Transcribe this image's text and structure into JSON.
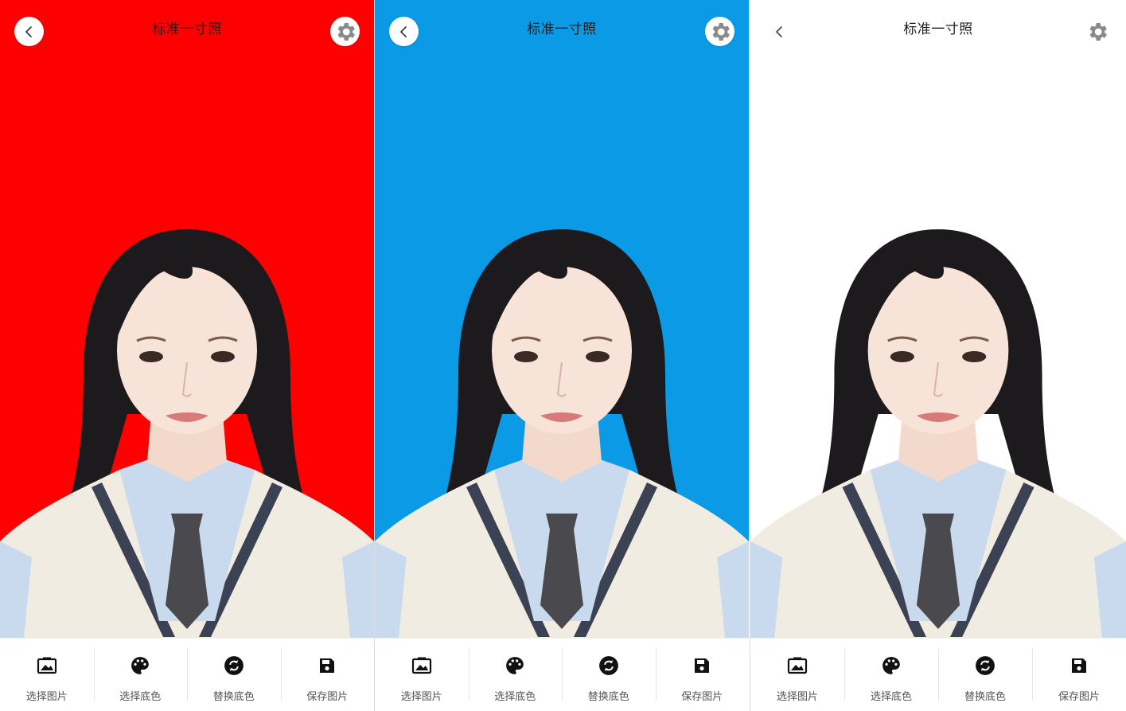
{
  "screens": [
    {
      "id": "red",
      "background_color": "#ff0000",
      "title": "标准一寸照",
      "toolbar": [
        "选择图片",
        "选择底色",
        "替换底色",
        "保存图片"
      ]
    },
    {
      "id": "blue",
      "background_color": "#0b9ae6",
      "title": "标准一寸照",
      "toolbar": [
        "选择图片",
        "选择底色",
        "替换底色",
        "保存图片"
      ]
    },
    {
      "id": "white",
      "background_color": "#ffffff",
      "title": "标准一寸照",
      "toolbar": [
        "选择图片",
        "选择底色",
        "替换底色",
        "保存图片"
      ]
    }
  ],
  "icons": {
    "back": "chevron-left-icon",
    "settings": "gear-icon",
    "tools": [
      "image-icon",
      "palette-icon",
      "refresh-icon",
      "save-icon"
    ]
  }
}
